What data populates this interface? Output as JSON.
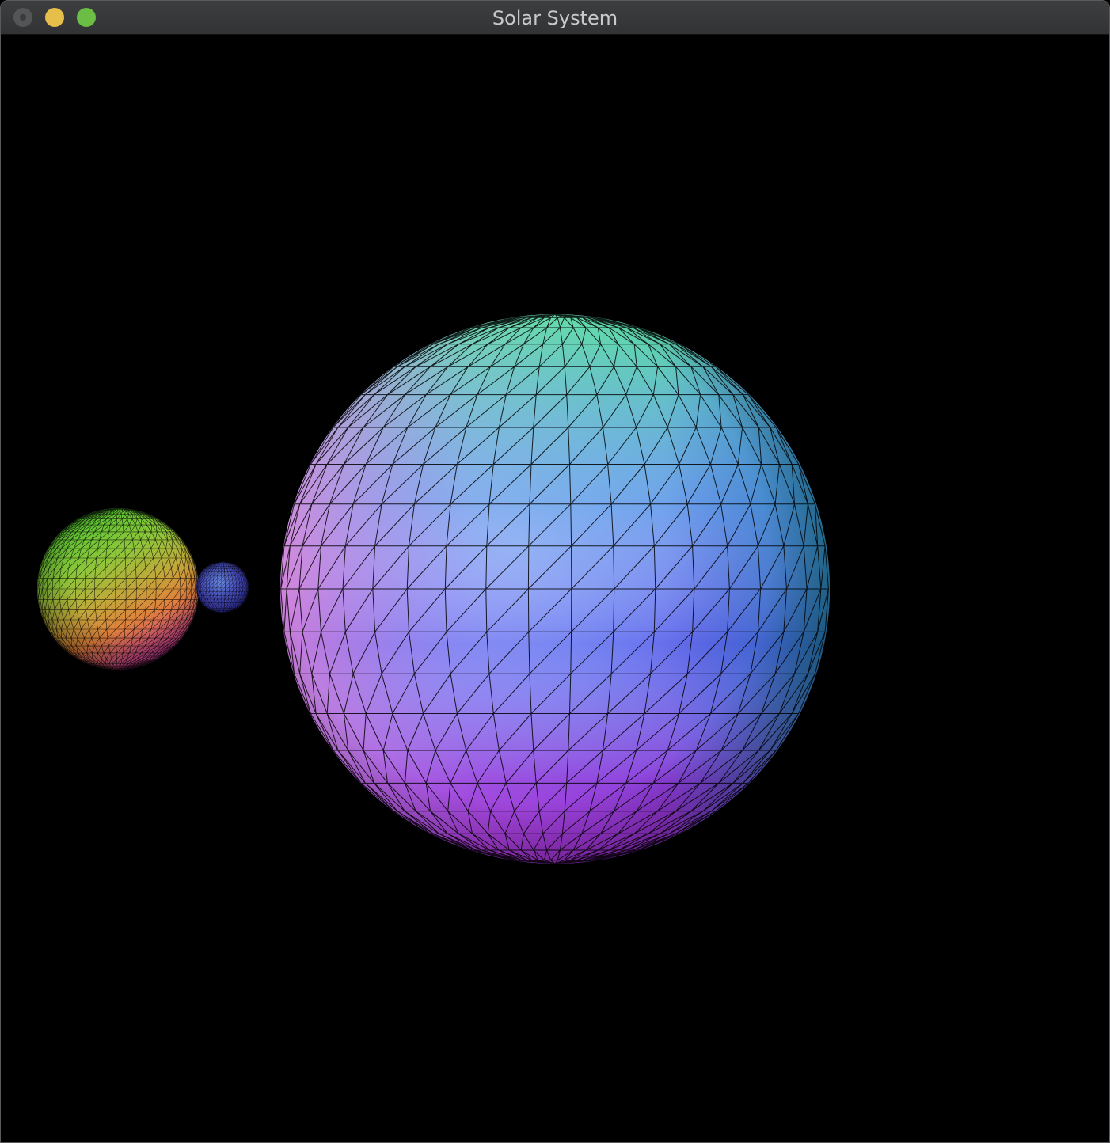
{
  "window": {
    "title": "Solar System"
  },
  "scene": {
    "background": "#000000",
    "wireframe_color": "#000000",
    "bodies": [
      {
        "name": "sun",
        "colors": [
          "#5ff59a",
          "#a79bf7",
          "#5c7cf3",
          "#e24ec8",
          "#7d3ae0",
          "#1c8fb0"
        ]
      },
      {
        "name": "planet",
        "colors": [
          "#5ed42e",
          "#cfd23c",
          "#e8873b",
          "#c93b9a"
        ]
      },
      {
        "name": "moon",
        "colors": [
          "#5f86d8",
          "#3d45b8",
          "#2e2d8f"
        ]
      }
    ]
  }
}
